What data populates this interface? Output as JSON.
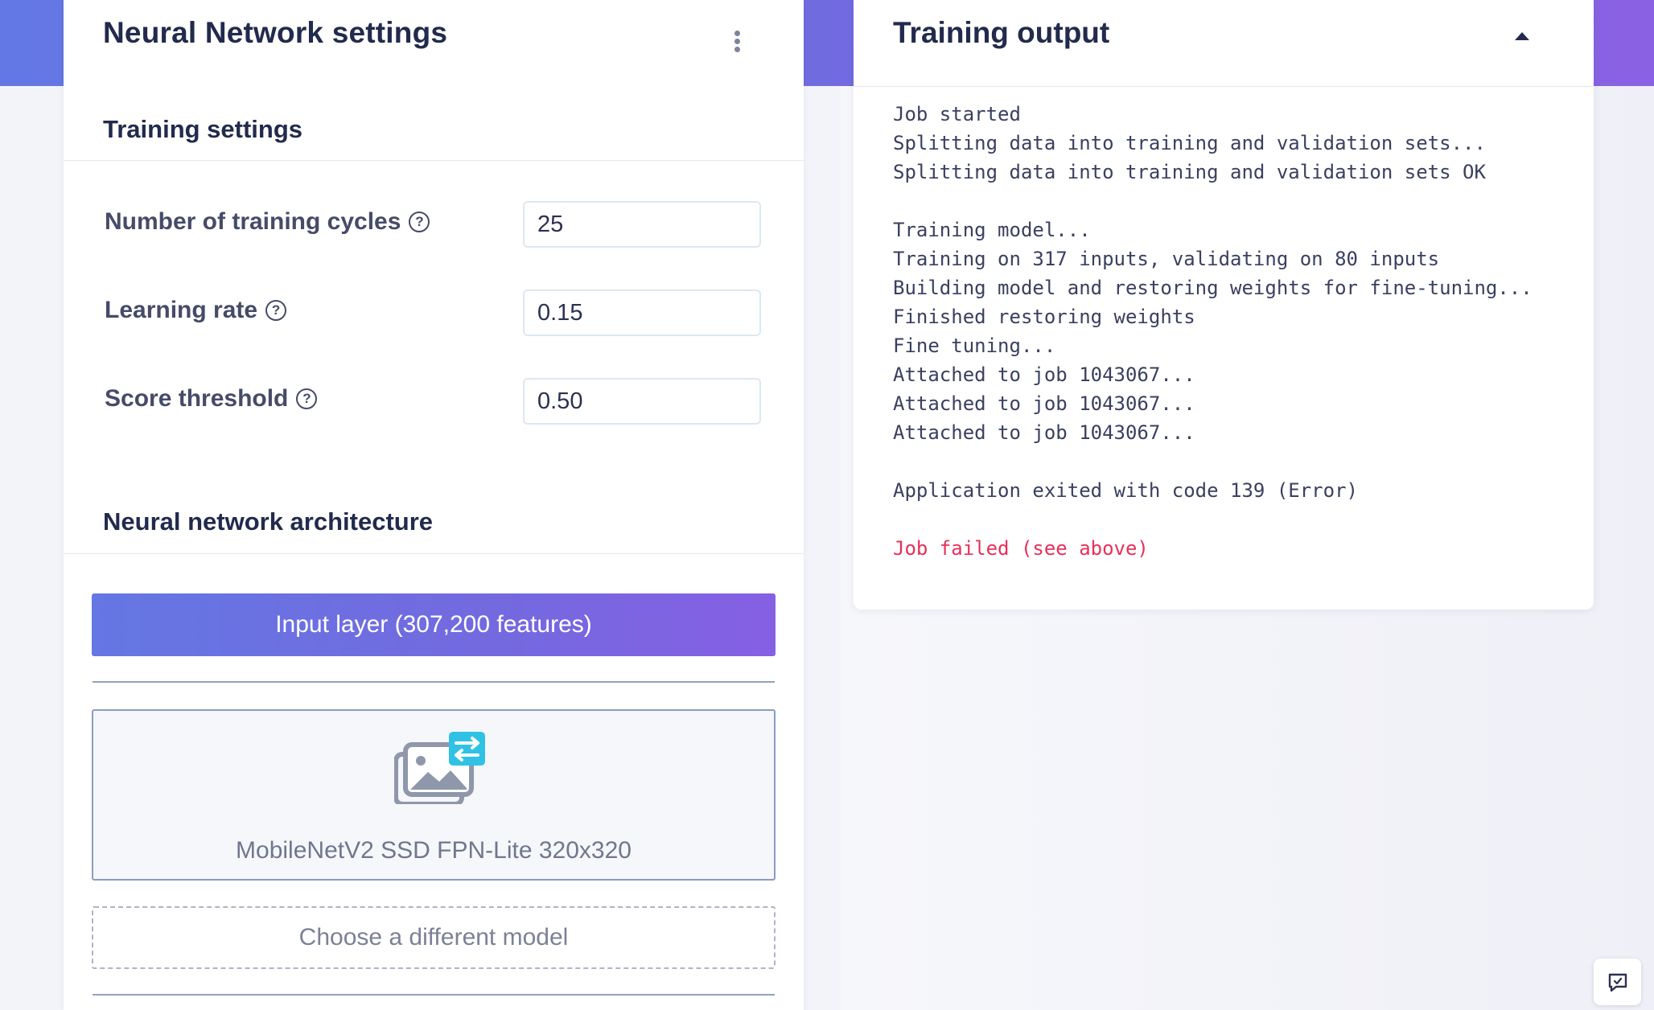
{
  "settings_panel": {
    "title": "Neural Network settings",
    "menu_icon": "kebab-vertical-icon",
    "training_settings": {
      "title": "Training settings",
      "fields": [
        {
          "label": "Number of training cycles",
          "value": "25",
          "help_icon": "question-circle-icon"
        },
        {
          "label": "Learning rate",
          "value": "0.15",
          "help_icon": "question-circle-icon"
        },
        {
          "label": "Score threshold",
          "value": "0.50",
          "help_icon": "question-circle-icon"
        }
      ]
    },
    "architecture": {
      "title": "Neural network architecture",
      "input_layer_label": "Input layer (307,200 features)",
      "model_icon": "image-transfer-icon",
      "model_name": "MobileNetV2 SSD FPN-Lite 320x320",
      "choose_model_label": "Choose a different model"
    }
  },
  "output_panel": {
    "title": "Training output",
    "collapse_icon": "caret-up-icon",
    "log": [
      {
        "text": "Job started",
        "type": "normal"
      },
      {
        "text": "Splitting data into training and validation sets...",
        "type": "normal"
      },
      {
        "text": "Splitting data into training and validation sets OK",
        "type": "normal"
      },
      {
        "text": "",
        "type": "normal"
      },
      {
        "text": "Training model...",
        "type": "normal"
      },
      {
        "text": "Training on 317 inputs, validating on 80 inputs",
        "type": "normal"
      },
      {
        "text": "Building model and restoring weights for fine-tuning...",
        "type": "normal"
      },
      {
        "text": "Finished restoring weights",
        "type": "normal"
      },
      {
        "text": "Fine tuning...",
        "type": "normal"
      },
      {
        "text": "Attached to job 1043067...",
        "type": "normal"
      },
      {
        "text": "Attached to job 1043067...",
        "type": "normal"
      },
      {
        "text": "Attached to job 1043067...",
        "type": "normal"
      },
      {
        "text": "",
        "type": "normal"
      },
      {
        "text": "Application exited with code 139 (Error)",
        "type": "normal"
      },
      {
        "text": "",
        "type": "normal"
      },
      {
        "text": "Job failed (see above)",
        "type": "error"
      }
    ]
  },
  "feedback_icon": "feedback-chat-icon",
  "colors": {
    "accent_gradient_start": "#6378e4",
    "accent_gradient_end": "#8a61e2",
    "error": "#e8305b",
    "page_background": "#f3f4f9"
  }
}
